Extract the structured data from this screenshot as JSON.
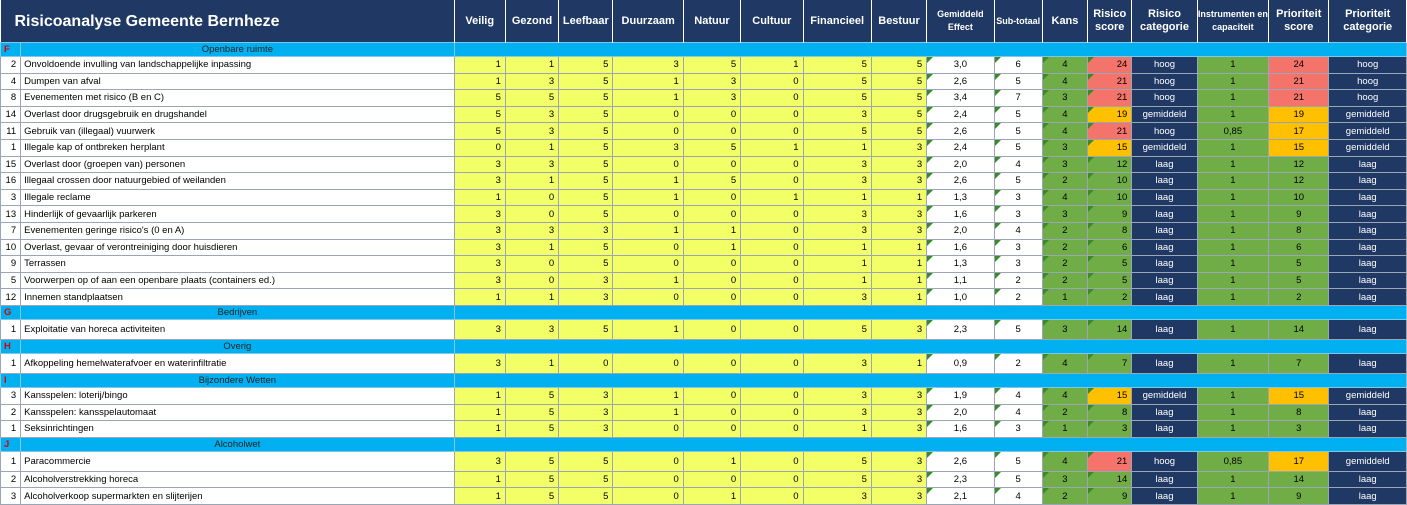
{
  "title": "Risicoanalyse Gemeente Bernheze",
  "headers": {
    "veilig": "Veilig",
    "gezond": "Gezond",
    "leefbaar": "Leefbaar",
    "duurzaam": "Duurzaam",
    "natuur": "Natuur",
    "cultuur": "Cultuur",
    "financieel": "Financieel",
    "bestuur": "Bestuur",
    "effect": "Gemiddeld Effect",
    "subtotaal": "Sub-totaal",
    "kans": "Kans",
    "risicoscore": "Risico score",
    "risicocat": "Risico categorie",
    "instr": "Instrumenten en capaciteit",
    "prioscore": "Prioriteit score",
    "priocat": "Prioriteit categorie"
  },
  "colors": {
    "header": "#1f3864",
    "section": "#00b0f0",
    "input": "#f2ff66",
    "laag": "#70ad47",
    "gemiddeld": "#ffc000",
    "hoog": "#f4736a"
  },
  "sections": [
    {
      "letter": "F",
      "title": "Openbare ruimte",
      "rows": [
        {
          "nr": "2",
          "name": "Onvoldoende invulling van landschappelijke inpassing",
          "v": [
            "1",
            "1",
            "5",
            "3",
            "5",
            "1",
            "5",
            "5"
          ],
          "effect": "3,0",
          "sub": "6",
          "kans": "4",
          "score": "24",
          "cat": "hoog",
          "instr": "1",
          "prio": "24",
          "pcat": "hoog",
          "level": "hoog",
          "plevel": "hoog"
        },
        {
          "nr": "4",
          "name": "Dumpen van afval",
          "v": [
            "1",
            "3",
            "5",
            "1",
            "3",
            "0",
            "5",
            "5"
          ],
          "effect": "2,6",
          "sub": "5",
          "kans": "4",
          "score": "21",
          "cat": "hoog",
          "instr": "1",
          "prio": "21",
          "pcat": "hoog",
          "level": "hoog",
          "plevel": "hoog"
        },
        {
          "nr": "8",
          "name": "Evenementen met risico (B en C)",
          "v": [
            "5",
            "5",
            "5",
            "1",
            "3",
            "0",
            "5",
            "5"
          ],
          "effect": "3,4",
          "sub": "7",
          "kans": "3",
          "score": "21",
          "cat": "hoog",
          "instr": "1",
          "prio": "21",
          "pcat": "hoog",
          "level": "hoog",
          "plevel": "hoog"
        },
        {
          "nr": "14",
          "name": "Overlast door drugsgebruik en drugshandel",
          "v": [
            "5",
            "3",
            "5",
            "0",
            "0",
            "0",
            "3",
            "5"
          ],
          "effect": "2,4",
          "sub": "5",
          "kans": "4",
          "score": "19",
          "cat": "gemiddeld",
          "instr": "1",
          "prio": "19",
          "pcat": "gemiddeld",
          "level": "gemiddeld",
          "plevel": "gemiddeld"
        },
        {
          "nr": "11",
          "name": "Gebruik van (illegaal) vuurwerk",
          "v": [
            "5",
            "3",
            "5",
            "0",
            "0",
            "0",
            "5",
            "5"
          ],
          "effect": "2,6",
          "sub": "5",
          "kans": "4",
          "score": "21",
          "cat": "hoog",
          "instr": "0,85",
          "prio": "17",
          "pcat": "gemiddeld",
          "level": "hoog",
          "plevel": "gemiddeld"
        },
        {
          "nr": "1",
          "name": "Illegale kap of ontbreken herplant",
          "v": [
            "0",
            "1",
            "5",
            "3",
            "5",
            "1",
            "1",
            "3"
          ],
          "effect": "2,4",
          "sub": "5",
          "kans": "3",
          "score": "15",
          "cat": "gemiddeld",
          "instr": "1",
          "prio": "15",
          "pcat": "gemiddeld",
          "level": "gemiddeld",
          "plevel": "gemiddeld"
        },
        {
          "nr": "15",
          "name": "Overlast door (groepen van) personen",
          "v": [
            "3",
            "3",
            "5",
            "0",
            "0",
            "0",
            "3",
            "3"
          ],
          "effect": "2,0",
          "sub": "4",
          "kans": "3",
          "score": "12",
          "cat": "laag",
          "instr": "1",
          "prio": "12",
          "pcat": "laag",
          "level": "laag",
          "plevel": "laag"
        },
        {
          "nr": "16",
          "name": "Illegaal crossen door natuurgebied of weilanden",
          "v": [
            "3",
            "1",
            "5",
            "1",
            "5",
            "0",
            "3",
            "3"
          ],
          "effect": "2,6",
          "sub": "5",
          "kans": "2",
          "score": "10",
          "cat": "laag",
          "instr": "1",
          "prio": "12",
          "pcat": "laag",
          "level": "laag",
          "plevel": "laag"
        },
        {
          "nr": "3",
          "name": "Illegale reclame",
          "v": [
            "1",
            "0",
            "5",
            "1",
            "0",
            "1",
            "1",
            "1"
          ],
          "effect": "1,3",
          "sub": "3",
          "kans": "4",
          "score": "10",
          "cat": "laag",
          "instr": "1",
          "prio": "10",
          "pcat": "laag",
          "level": "laag",
          "plevel": "laag"
        },
        {
          "nr": "13",
          "name": "Hinderlijk of gevaarlijk parkeren",
          "v": [
            "3",
            "0",
            "5",
            "0",
            "0",
            "0",
            "3",
            "3"
          ],
          "effect": "1,6",
          "sub": "3",
          "kans": "3",
          "score": "9",
          "cat": "laag",
          "instr": "1",
          "prio": "9",
          "pcat": "laag",
          "level": "laag",
          "plevel": "laag"
        },
        {
          "nr": "7",
          "name": "Evenementen geringe risico's (0 en A)",
          "v": [
            "3",
            "3",
            "3",
            "1",
            "1",
            "0",
            "3",
            "3"
          ],
          "effect": "2,0",
          "sub": "4",
          "kans": "2",
          "score": "8",
          "cat": "laag",
          "instr": "1",
          "prio": "8",
          "pcat": "laag",
          "level": "laag",
          "plevel": "laag"
        },
        {
          "nr": "10",
          "name": "Overlast, gevaar of verontreiniging door huisdieren",
          "v": [
            "3",
            "1",
            "5",
            "0",
            "1",
            "0",
            "1",
            "1"
          ],
          "effect": "1,6",
          "sub": "3",
          "kans": "2",
          "score": "6",
          "cat": "laag",
          "instr": "1",
          "prio": "6",
          "pcat": "laag",
          "level": "laag",
          "plevel": "laag"
        },
        {
          "nr": "9",
          "name": "Terrassen",
          "v": [
            "3",
            "0",
            "5",
            "0",
            "0",
            "0",
            "1",
            "1"
          ],
          "effect": "1,3",
          "sub": "3",
          "kans": "2",
          "score": "5",
          "cat": "laag",
          "instr": "1",
          "prio": "5",
          "pcat": "laag",
          "level": "laag",
          "plevel": "laag"
        },
        {
          "nr": "5",
          "name": "Voorwerpen op of aan een openbare plaats (containers ed.)",
          "v": [
            "3",
            "0",
            "3",
            "1",
            "0",
            "0",
            "1",
            "1"
          ],
          "effect": "1,1",
          "sub": "2",
          "kans": "2",
          "score": "5",
          "cat": "laag",
          "instr": "1",
          "prio": "5",
          "pcat": "laag",
          "level": "laag",
          "plevel": "laag"
        },
        {
          "nr": "12",
          "name": "Innemen standplaatsen",
          "v": [
            "1",
            "1",
            "3",
            "0",
            "0",
            "0",
            "3",
            "1"
          ],
          "effect": "1,0",
          "sub": "2",
          "kans": "1",
          "score": "2",
          "cat": "laag",
          "instr": "1",
          "prio": "2",
          "pcat": "laag",
          "level": "laag",
          "plevel": "laag"
        }
      ]
    },
    {
      "letter": "G",
      "title": "Bedrijven",
      "rows": [
        {
          "nr": "1",
          "name": "Exploitatie van horeca activiteiten",
          "v": [
            "3",
            "3",
            "5",
            "1",
            "0",
            "0",
            "5",
            "3"
          ],
          "effect": "2,3",
          "sub": "5",
          "kans": "3",
          "score": "14",
          "cat": "laag",
          "instr": "1",
          "prio": "14",
          "pcat": "laag",
          "level": "laag",
          "plevel": "laag",
          "tall": true
        }
      ]
    },
    {
      "letter": "H",
      "title": "Overig",
      "rows": [
        {
          "nr": "1",
          "name": "Afkoppeling hemelwaterafvoer en waterinfiltratie",
          "v": [
            "3",
            "1",
            "0",
            "0",
            "0",
            "0",
            "3",
            "1"
          ],
          "effect": "0,9",
          "sub": "2",
          "kans": "4",
          "score": "7",
          "cat": "laag",
          "instr": "1",
          "prio": "7",
          "pcat": "laag",
          "level": "laag",
          "plevel": "laag",
          "tall": true
        }
      ]
    },
    {
      "letter": "I",
      "title": "Bijzondere Wetten",
      "rows": [
        {
          "nr": "3",
          "name": "Kansspelen: loterij/bingo",
          "v": [
            "1",
            "5",
            "3",
            "1",
            "0",
            "0",
            "3",
            "3"
          ],
          "effect": "1,9",
          "sub": "4",
          "kans": "4",
          "score": "15",
          "cat": "gemiddeld",
          "instr": "1",
          "prio": "15",
          "pcat": "gemiddeld",
          "level": "gemiddeld",
          "plevel": "gemiddeld"
        },
        {
          "nr": "2",
          "name": "Kansspelen: kansspelautomaat",
          "v": [
            "1",
            "5",
            "3",
            "1",
            "0",
            "0",
            "3",
            "3"
          ],
          "effect": "2,0",
          "sub": "4",
          "kans": "2",
          "score": "8",
          "cat": "laag",
          "instr": "1",
          "prio": "8",
          "pcat": "laag",
          "level": "laag",
          "plevel": "laag"
        },
        {
          "nr": "1",
          "name": "Seksinrichtingen",
          "v": [
            "1",
            "5",
            "3",
            "0",
            "0",
            "0",
            "1",
            "3"
          ],
          "effect": "1,6",
          "sub": "3",
          "kans": "1",
          "score": "3",
          "cat": "laag",
          "instr": "1",
          "prio": "3",
          "pcat": "laag",
          "level": "laag",
          "plevel": "laag"
        }
      ]
    },
    {
      "letter": "J",
      "title": "Alcoholwet",
      "rows": [
        {
          "nr": "1",
          "name": "Paracommercie",
          "v": [
            "3",
            "5",
            "5",
            "0",
            "1",
            "0",
            "5",
            "3"
          ],
          "effect": "2,6",
          "sub": "5",
          "kans": "4",
          "score": "21",
          "cat": "hoog",
          "instr": "0,85",
          "prio": "17",
          "pcat": "gemiddeld",
          "level": "hoog",
          "plevel": "gemiddeld",
          "tall": true
        },
        {
          "nr": "2",
          "name": "Alcoholverstrekking horeca",
          "v": [
            "1",
            "5",
            "5",
            "0",
            "0",
            "0",
            "5",
            "3"
          ],
          "effect": "2,3",
          "sub": "5",
          "kans": "3",
          "score": "14",
          "cat": "laag",
          "instr": "1",
          "prio": "14",
          "pcat": "laag",
          "level": "laag",
          "plevel": "laag"
        },
        {
          "nr": "3",
          "name": "Alcoholverkoop supermarkten en slijterijen",
          "v": [
            "1",
            "5",
            "5",
            "0",
            "1",
            "0",
            "3",
            "3"
          ],
          "effect": "2,1",
          "sub": "4",
          "kans": "2",
          "score": "9",
          "cat": "laag",
          "instr": "1",
          "prio": "9",
          "pcat": "laag",
          "level": "laag",
          "plevel": "laag"
        }
      ]
    }
  ]
}
